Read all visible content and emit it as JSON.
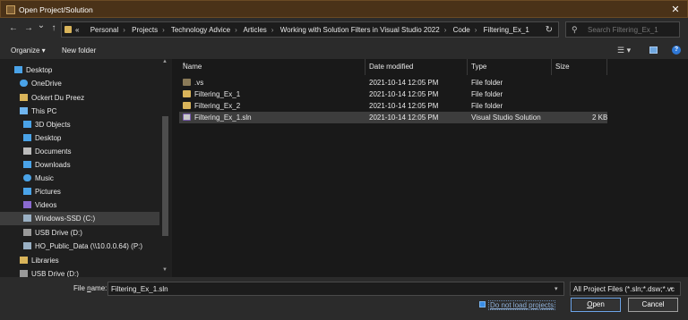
{
  "window": {
    "title": "Open Project/Solution",
    "close_glyph": "✕"
  },
  "nav_buttons": {
    "back": "←",
    "forward": "→",
    "recent": "⌄",
    "up": "↑"
  },
  "address": {
    "overflow": "«",
    "crumbs": [
      "Personal",
      "Projects",
      "Technology Advice",
      "Articles",
      "Working with Solution Filters in Visual Studio 2022",
      "Code",
      "Filtering_Ex_1"
    ],
    "separator": "›",
    "refresh_glyph": "↻"
  },
  "search": {
    "placeholder": "Search Filtering_Ex_1"
  },
  "toolbar": {
    "organize": "Organize ▾",
    "new_folder": "New folder",
    "view_glyph": "☰ ▾",
    "help_glyph": "?"
  },
  "nav": {
    "items": [
      {
        "label": "Desktop",
        "icon": "desktop-icon",
        "color": "#4aa3e8"
      },
      {
        "label": "OneDrive",
        "icon": "cloud-icon",
        "color": "#4aa3e8"
      },
      {
        "label": "Ockert Du Preez",
        "icon": "user-folder-icon",
        "color": "#d9b45a"
      },
      {
        "label": "This PC",
        "icon": "pc-icon",
        "color": "#6fb4ee"
      },
      {
        "label": "3D Objects",
        "icon": "cube-icon",
        "color": "#4aa3e8"
      },
      {
        "label": "Desktop",
        "icon": "desktop-icon",
        "color": "#4aa3e8"
      },
      {
        "label": "Documents",
        "icon": "document-icon",
        "color": "#bcbcbc"
      },
      {
        "label": "Downloads",
        "icon": "download-icon",
        "color": "#4aa3e8"
      },
      {
        "label": "Music",
        "icon": "music-icon",
        "color": "#4aa3e8"
      },
      {
        "label": "Pictures",
        "icon": "picture-icon",
        "color": "#4aa3e8"
      },
      {
        "label": "Videos",
        "icon": "video-icon",
        "color": "#8a6ad0"
      },
      {
        "label": "Windows-SSD (C:)",
        "icon": "drive-icon",
        "color": "#9ab0c4"
      },
      {
        "label": "USB Drive (D:)",
        "icon": "usb-drive-icon",
        "color": "#9a9a9a"
      },
      {
        "label": "HO_Public_Data (\\\\10.0.0.64) (P:)",
        "icon": "network-drive-icon",
        "color": "#9ab0c4"
      },
      {
        "label": "Libraries",
        "icon": "library-icon",
        "color": "#d9b45a"
      },
      {
        "label": "USB Drive (D:)",
        "icon": "usb-drive-icon",
        "color": "#9a9a9a"
      }
    ],
    "selected_index": 11,
    "scroll_up": "▲",
    "scroll_down": "▼"
  },
  "columns": {
    "name": "Name",
    "date": "Date modified",
    "type": "Type",
    "size": "Size",
    "sort_glyph": "^"
  },
  "files": [
    {
      "name": ".vs",
      "date": "2021-10-14 12:05 PM",
      "type": "File folder",
      "size": "",
      "icon": "folder-icon"
    },
    {
      "name": "Filtering_Ex_1",
      "date": "2021-10-14 12:05 PM",
      "type": "File folder",
      "size": "",
      "icon": "folder-icon"
    },
    {
      "name": "Filtering_Ex_2",
      "date": "2021-10-14 12:05 PM",
      "type": "File folder",
      "size": "",
      "icon": "folder-icon"
    },
    {
      "name": "Filtering_Ex_1.sln",
      "date": "2021-10-14 12:05 PM",
      "type": "Visual Studio Solution",
      "size": "2 KB",
      "icon": "solution-file-icon"
    }
  ],
  "selected_file_index": 3,
  "bottom": {
    "file_name_label_pre": "File ",
    "file_name_label_u": "n",
    "file_name_label_post": "ame:",
    "file_name_value": "Filtering_Ex_1.sln",
    "dropdown_glyph": "▾",
    "filter_value": "All Project Files (*.sln;*.dsw;*.vc",
    "do_not_load": "Do not load projects",
    "do_not_load_checked": true,
    "open_u": "O",
    "open_rest": "pen",
    "cancel": "Cancel"
  }
}
